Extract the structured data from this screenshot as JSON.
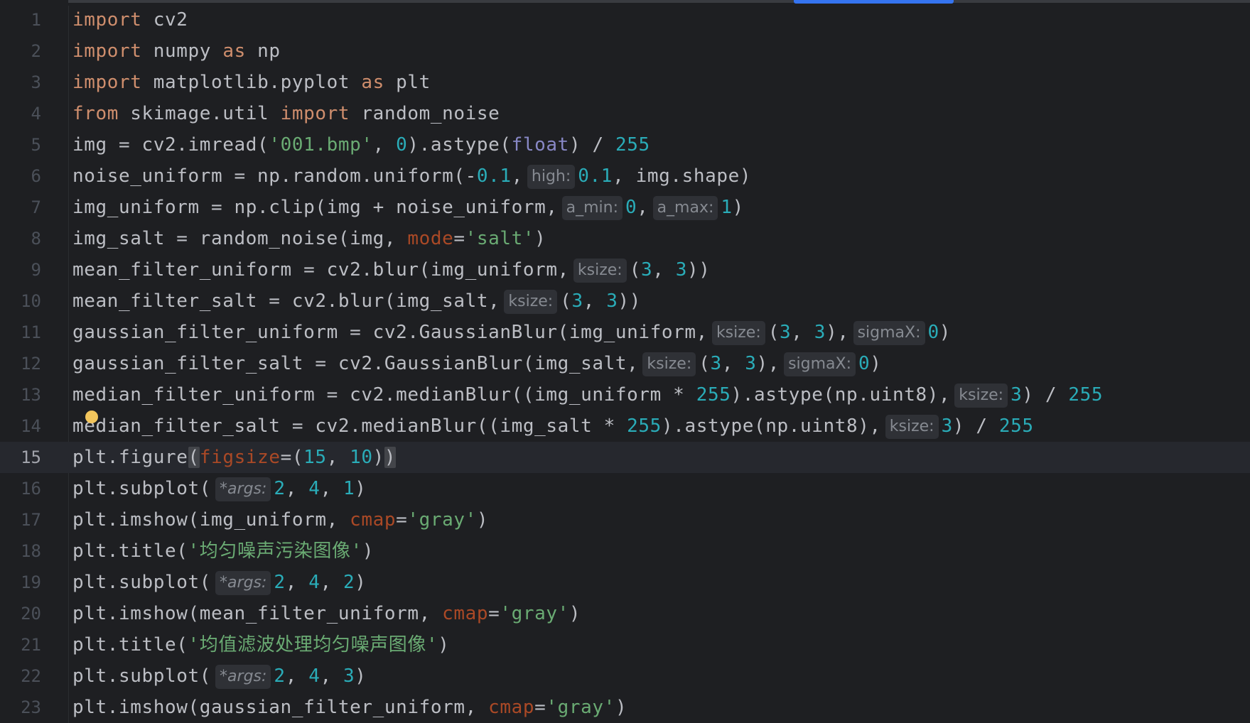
{
  "editor": {
    "language": "python",
    "current_line": 15,
    "colors": {
      "background": "#1e1f22",
      "keyword": "#cf8e6d",
      "number": "#2aacb8",
      "string": "#6aab73",
      "builtin": "#8888c6",
      "named_argument": "#aa4926",
      "plain": "#bcbec4",
      "line_number": "#4b5059",
      "accent": "#3574f0",
      "intention_bulb": "#f2c55c"
    },
    "lines": [
      {
        "n": "1",
        "tokens": [
          {
            "t": "import",
            "c": "kw"
          },
          {
            "t": " cv2",
            "c": "pl"
          }
        ]
      },
      {
        "n": "2",
        "tokens": [
          {
            "t": "import",
            "c": "kw"
          },
          {
            "t": " numpy ",
            "c": "pl"
          },
          {
            "t": "as",
            "c": "kw"
          },
          {
            "t": " np",
            "c": "pl"
          }
        ]
      },
      {
        "n": "3",
        "tokens": [
          {
            "t": "import",
            "c": "kw"
          },
          {
            "t": " matplotlib.pyplot ",
            "c": "pl"
          },
          {
            "t": "as",
            "c": "kw"
          },
          {
            "t": " plt",
            "c": "pl"
          }
        ]
      },
      {
        "n": "4",
        "tokens": [
          {
            "t": "from",
            "c": "kw"
          },
          {
            "t": " skimage.util ",
            "c": "pl"
          },
          {
            "t": "import",
            "c": "kw"
          },
          {
            "t": " random_noise",
            "c": "pl"
          }
        ]
      },
      {
        "n": "5",
        "tokens": [
          {
            "t": "img = cv2.imread(",
            "c": "pl"
          },
          {
            "t": "'001.bmp'",
            "c": "str"
          },
          {
            "t": ", ",
            "c": "pl"
          },
          {
            "t": "0",
            "c": "num"
          },
          {
            "t": ").astype(",
            "c": "pl"
          },
          {
            "t": "float",
            "c": "builtin"
          },
          {
            "t": ") / ",
            "c": "pl"
          },
          {
            "t": "255",
            "c": "num"
          }
        ]
      },
      {
        "n": "6",
        "tokens": [
          {
            "t": "noise_uniform = np.random.uniform(-",
            "c": "pl"
          },
          {
            "t": "0.1",
            "c": "num"
          },
          {
            "t": ",",
            "c": "pl"
          },
          {
            "t": "high:",
            "c": "hint"
          },
          {
            "t": "0.1",
            "c": "num"
          },
          {
            "t": ", img.shape)",
            "c": "pl"
          }
        ]
      },
      {
        "n": "7",
        "tokens": [
          {
            "t": "img_uniform = np.clip(img + noise_uniform,",
            "c": "pl"
          },
          {
            "t": "a_min:",
            "c": "hint"
          },
          {
            "t": "0",
            "c": "num"
          },
          {
            "t": ",",
            "c": "pl"
          },
          {
            "t": "a_max:",
            "c": "hint"
          },
          {
            "t": "1",
            "c": "num"
          },
          {
            "t": ")",
            "c": "pl"
          }
        ]
      },
      {
        "n": "8",
        "tokens": [
          {
            "t": "img_salt = random_noise(img, ",
            "c": "pl"
          },
          {
            "t": "mode",
            "c": "named"
          },
          {
            "t": "=",
            "c": "pl"
          },
          {
            "t": "'salt'",
            "c": "str"
          },
          {
            "t": ")",
            "c": "pl"
          }
        ]
      },
      {
        "n": "9",
        "tokens": [
          {
            "t": "mean_filter_uniform = cv2.blur(img_uniform,",
            "c": "pl"
          },
          {
            "t": "ksize:",
            "c": "hint"
          },
          {
            "t": "(",
            "c": "pl"
          },
          {
            "t": "3",
            "c": "num"
          },
          {
            "t": ", ",
            "c": "pl"
          },
          {
            "t": "3",
            "c": "num"
          },
          {
            "t": "))",
            "c": "pl"
          }
        ]
      },
      {
        "n": "10",
        "tokens": [
          {
            "t": "mean_filter_salt = cv2.blur(img_salt,",
            "c": "pl"
          },
          {
            "t": "ksize:",
            "c": "hint"
          },
          {
            "t": "(",
            "c": "pl"
          },
          {
            "t": "3",
            "c": "num"
          },
          {
            "t": ", ",
            "c": "pl"
          },
          {
            "t": "3",
            "c": "num"
          },
          {
            "t": "))",
            "c": "pl"
          }
        ]
      },
      {
        "n": "11",
        "tokens": [
          {
            "t": "gaussian_filter_uniform = cv2.GaussianBlur(img_uniform,",
            "c": "pl"
          },
          {
            "t": "ksize:",
            "c": "hint"
          },
          {
            "t": "(",
            "c": "pl"
          },
          {
            "t": "3",
            "c": "num"
          },
          {
            "t": ", ",
            "c": "pl"
          },
          {
            "t": "3",
            "c": "num"
          },
          {
            "t": "),",
            "c": "pl"
          },
          {
            "t": "sigmaX:",
            "c": "hint"
          },
          {
            "t": "0",
            "c": "num"
          },
          {
            "t": ")",
            "c": "pl"
          }
        ]
      },
      {
        "n": "12",
        "tokens": [
          {
            "t": "gaussian_filter_salt = cv2.GaussianBlur(img_salt,",
            "c": "pl"
          },
          {
            "t": "ksize:",
            "c": "hint"
          },
          {
            "t": "(",
            "c": "pl"
          },
          {
            "t": "3",
            "c": "num"
          },
          {
            "t": ", ",
            "c": "pl"
          },
          {
            "t": "3",
            "c": "num"
          },
          {
            "t": "),",
            "c": "pl"
          },
          {
            "t": "sigmaX:",
            "c": "hint"
          },
          {
            "t": "0",
            "c": "num"
          },
          {
            "t": ")",
            "c": "pl"
          }
        ]
      },
      {
        "n": "13",
        "tokens": [
          {
            "t": "median_filter_uniform = cv2.medianBlur((img_uniform * ",
            "c": "pl"
          },
          {
            "t": "255",
            "c": "num"
          },
          {
            "t": ").astype(np.uint8),",
            "c": "pl"
          },
          {
            "t": "ksize:",
            "c": "hint"
          },
          {
            "t": "3",
            "c": "num"
          },
          {
            "t": ") / ",
            "c": "pl"
          },
          {
            "t": "255",
            "c": "num"
          }
        ]
      },
      {
        "n": "14",
        "tokens": [
          {
            "t": "median_filter_salt = cv2.medianBlur((img_salt * ",
            "c": "pl"
          },
          {
            "t": "255",
            "c": "num"
          },
          {
            "t": ").astype(np.uint8),",
            "c": "pl"
          },
          {
            "t": "ksize:",
            "c": "hint"
          },
          {
            "t": "3",
            "c": "num"
          },
          {
            "t": ") / ",
            "c": "pl"
          },
          {
            "t": "255",
            "c": "num"
          }
        ]
      },
      {
        "n": "15",
        "tokens": [
          {
            "t": "plt.figure",
            "c": "pl"
          },
          {
            "t": "(",
            "c": "brace"
          },
          {
            "t": "figsize",
            "c": "named"
          },
          {
            "t": "=(",
            "c": "pl"
          },
          {
            "t": "15",
            "c": "num"
          },
          {
            "t": ", ",
            "c": "pl"
          },
          {
            "t": "10",
            "c": "num"
          },
          {
            "t": ")",
            "c": "pl"
          },
          {
            "t": ")",
            "c": "brace"
          }
        ]
      },
      {
        "n": "16",
        "tokens": [
          {
            "t": "plt.subplot(",
            "c": "pl"
          },
          {
            "t": "*args:",
            "c": "hint-i"
          },
          {
            "t": "2",
            "c": "num"
          },
          {
            "t": ", ",
            "c": "pl"
          },
          {
            "t": "4",
            "c": "num"
          },
          {
            "t": ", ",
            "c": "pl"
          },
          {
            "t": "1",
            "c": "num"
          },
          {
            "t": ")",
            "c": "pl"
          }
        ]
      },
      {
        "n": "17",
        "tokens": [
          {
            "t": "plt.imshow(img_uniform, ",
            "c": "pl"
          },
          {
            "t": "cmap",
            "c": "named"
          },
          {
            "t": "=",
            "c": "pl"
          },
          {
            "t": "'gray'",
            "c": "str"
          },
          {
            "t": ")",
            "c": "pl"
          }
        ]
      },
      {
        "n": "18",
        "tokens": [
          {
            "t": "plt.title(",
            "c": "pl"
          },
          {
            "t": "'均匀噪声污染图像'",
            "c": "str"
          },
          {
            "t": ")",
            "c": "pl"
          }
        ]
      },
      {
        "n": "19",
        "tokens": [
          {
            "t": "plt.subplot(",
            "c": "pl"
          },
          {
            "t": "*args:",
            "c": "hint-i"
          },
          {
            "t": "2",
            "c": "num"
          },
          {
            "t": ", ",
            "c": "pl"
          },
          {
            "t": "4",
            "c": "num"
          },
          {
            "t": ", ",
            "c": "pl"
          },
          {
            "t": "2",
            "c": "num"
          },
          {
            "t": ")",
            "c": "pl"
          }
        ]
      },
      {
        "n": "20",
        "tokens": [
          {
            "t": "plt.imshow(mean_filter_uniform, ",
            "c": "pl"
          },
          {
            "t": "cmap",
            "c": "named"
          },
          {
            "t": "=",
            "c": "pl"
          },
          {
            "t": "'gray'",
            "c": "str"
          },
          {
            "t": ")",
            "c": "pl"
          }
        ]
      },
      {
        "n": "21",
        "tokens": [
          {
            "t": "plt.title(",
            "c": "pl"
          },
          {
            "t": "'均值滤波处理均匀噪声图像'",
            "c": "str"
          },
          {
            "t": ")",
            "c": "pl"
          }
        ]
      },
      {
        "n": "22",
        "tokens": [
          {
            "t": "plt.subplot(",
            "c": "pl"
          },
          {
            "t": "*args:",
            "c": "hint-i"
          },
          {
            "t": "2",
            "c": "num"
          },
          {
            "t": ", ",
            "c": "pl"
          },
          {
            "t": "4",
            "c": "num"
          },
          {
            "t": ", ",
            "c": "pl"
          },
          {
            "t": "3",
            "c": "num"
          },
          {
            "t": ")",
            "c": "pl"
          }
        ]
      },
      {
        "n": "23",
        "tokens": [
          {
            "t": "plt.imshow(gaussian_filter_uniform, ",
            "c": "pl"
          },
          {
            "t": "cmap",
            "c": "named"
          },
          {
            "t": "=",
            "c": "pl"
          },
          {
            "t": "'gray'",
            "c": "str"
          },
          {
            "t": ")",
            "c": "pl"
          }
        ]
      }
    ]
  }
}
